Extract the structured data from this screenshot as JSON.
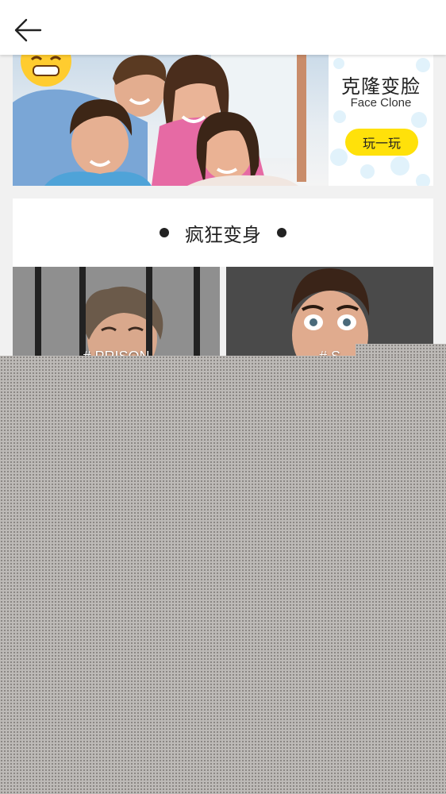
{
  "header": {
    "back_icon": "arrow-left-icon"
  },
  "banner": {
    "ad_title": "克隆变脸",
    "ad_subtitle": "Face Clone",
    "ad_button_label": "玩一玩",
    "ad_button_color": "#ffe10a",
    "emoji_icon": "emoji-face-icon"
  },
  "section": {
    "title": "疯狂变身"
  },
  "cards": [
    {
      "label": "# PRISON"
    },
    {
      "label": "# S"
    }
  ],
  "colors": {
    "topbar": "#ffffff",
    "page_background": "#f1f1f1",
    "overlay": "#bdbab7"
  }
}
